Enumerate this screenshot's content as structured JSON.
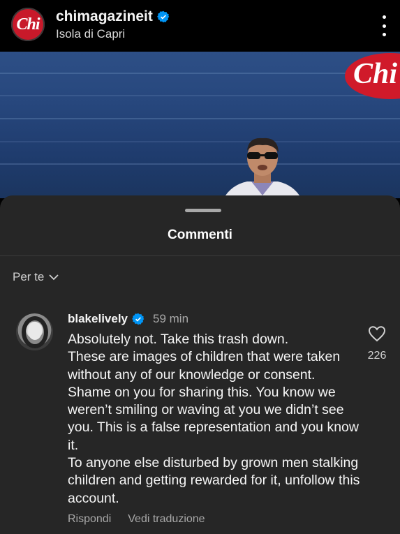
{
  "header": {
    "account_name": "chimagazineit",
    "location": "Isola di Capri",
    "logo_text": "Chi"
  },
  "post": {
    "watermark_text": "Chi"
  },
  "comments_sheet": {
    "title": "Commenti",
    "filter_label": "Per te",
    "comment": {
      "username": "blakelively",
      "time": "59 min",
      "text": "Absolutely not. Take this trash down.\nThese are images of children that were taken without any of our knowledge or consent. Shame on you for sharing this. You know we weren’t smiling or waving at you we didn’t see you. This is a false representation and you know it.\nTo anyone else disturbed by grown men stalking children and getting rewarded for it, unfollow this account.",
      "likes": "226",
      "reply_label": "Rispondi",
      "translate_label": "Vedi traduzione"
    }
  },
  "colors": {
    "verified_blue": "#0095f6",
    "sheet_background": "#262626",
    "brand_red": "#c8192a"
  }
}
